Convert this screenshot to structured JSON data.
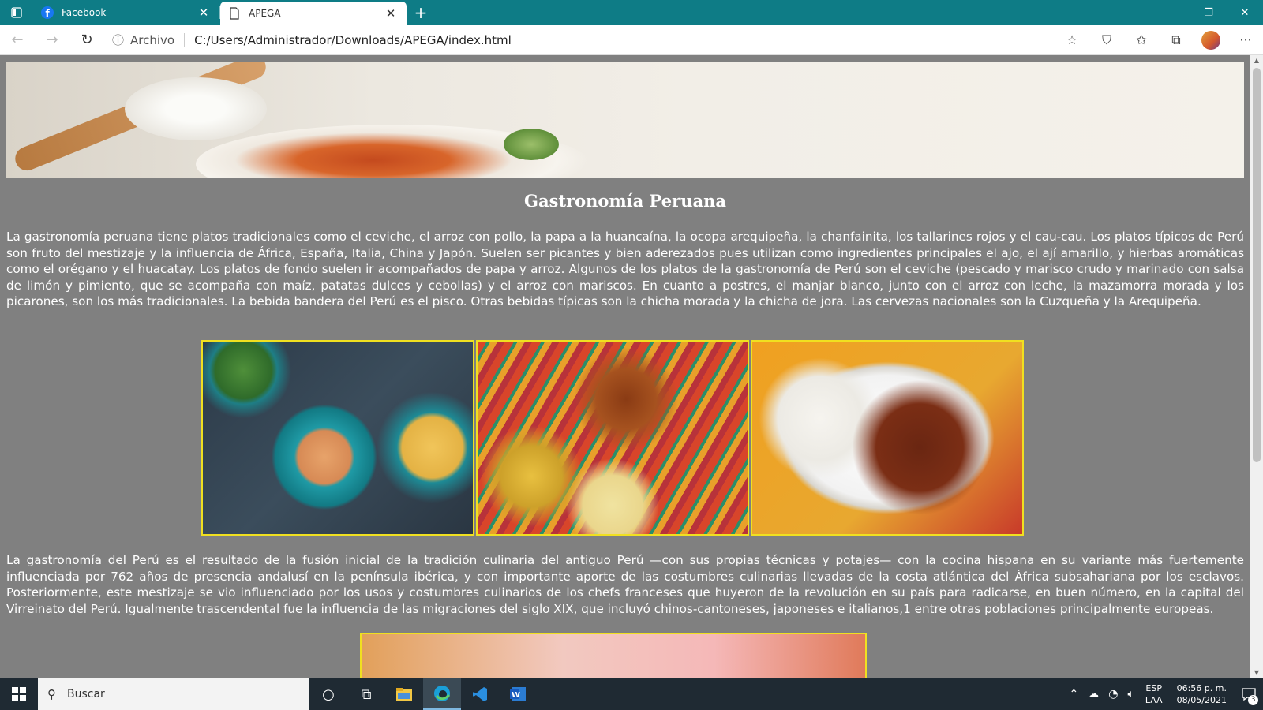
{
  "browser": {
    "tabs": [
      {
        "label": "Facebook",
        "icon": "facebook-icon",
        "active": false
      },
      {
        "label": "APEGA",
        "icon": "page-icon",
        "active": true
      }
    ],
    "address_prefix": "Archivo",
    "url": "C:/Users/Administrador/Downloads/APEGA/index.html"
  },
  "page": {
    "title": "Gastronomía Peruana",
    "paragraph1": "La gastronomía peruana tiene platos tradicionales como el ceviche, el arroz con pollo, la papa a la huancaína, la ocopa arequipeña, la chanfainita, los tallarines rojos y el cau-cau. Los platos típicos de Perú son fruto del mestizaje y la influencia de África, España, Italia, China y Japón. Suelen ser picantes y bien aderezados pues utilizan como ingredientes principales el ajo, el ají amarillo, y hierbas aromáticas como el orégano y el huacatay. Los platos de fondo suelen ir acompañados de papa y arroz. Algunos de los platos de la gastronomía de Perú son el ceviche (pescado y marisco crudo y marinado con salsa de limón y pimiento, que se acompaña con maíz, patatas dulces y cebollas) y el arroz con mariscos. En cuanto a postres, el manjar blanco, junto con el arroz con leche, la mazamorra morada y los picarones, son los más tradicionales. La bebida bandera del Perú es el pisco. Otras bebidas típicas son la chicha morada y la chicha de jora. Las cervezas nacionales son la Cuzqueña y la Arequipeña.",
    "paragraph2": "La gastronomía del Perú es el resultado de la fusión inicial de la tradición culinaria del antiguo Perú —con sus propias técnicas y potajes— con la cocina hispana en su variante más fuertemente influenciada por 762 años de presencia andalusí en la península ibérica, y con importante aporte de las costumbres culinarias llevadas de la costa atlántica del África subsahariana por los esclavos. Posteriormente, este mestizaje se vio influenciado por los usos y costumbres culinarios de los chefs franceses que huyeron de la revolución en su país para radicarse, en buen número, en la capital del Virreinato del Perú. Igualmente trascendental fue la influencia de las migraciones del siglo XIX, que incluyó chinos-cantoneses, japoneses e italianos,1 entre otras poblaciones principalmente europeas."
  },
  "taskbar": {
    "search_placeholder": "Buscar",
    "lang_line1": "ESP",
    "lang_line2": "LAA",
    "time": "06:56 p. m.",
    "date": "08/05/2021",
    "notifications": "3"
  },
  "colors": {
    "tabbar": "#0e7c86",
    "page_bg": "#808080",
    "image_border": "#f0e020"
  }
}
